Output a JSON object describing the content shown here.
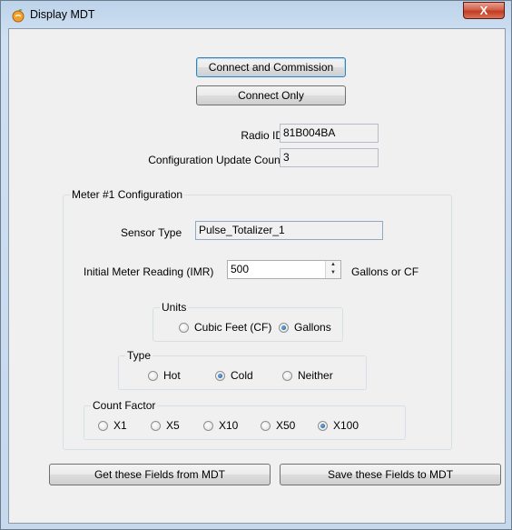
{
  "window": {
    "title": "Display MDT",
    "close_label": "X"
  },
  "buttons": {
    "connect_commission": "Connect and Commission",
    "connect_only": "Connect Only",
    "get_fields": "Get these Fields from MDT",
    "save_fields": "Save these Fields to MDT"
  },
  "radio_id": {
    "label": "Radio ID",
    "value": "81B004BA"
  },
  "config_update": {
    "label": "Configuration Update Count",
    "value": "3"
  },
  "meter_group": {
    "legend": "Meter #1 Configuration",
    "sensor_type": {
      "label": "Sensor Type",
      "value": "Pulse_Totalizer_1"
    },
    "imr": {
      "label": "Initial Meter Reading (IMR)",
      "value": "500",
      "suffix": "Gallons or CF"
    },
    "units": {
      "legend": "Units",
      "options": [
        "Cubic Feet (CF)",
        "Gallons"
      ],
      "selected": "Gallons"
    },
    "type": {
      "legend": "Type",
      "options": [
        "Hot",
        "Cold",
        "Neither"
      ],
      "selected": "Cold"
    },
    "count_factor": {
      "legend": "Count Factor",
      "options": [
        "X1",
        "X5",
        "X10",
        "X50",
        "X100"
      ],
      "selected": "X100"
    }
  }
}
